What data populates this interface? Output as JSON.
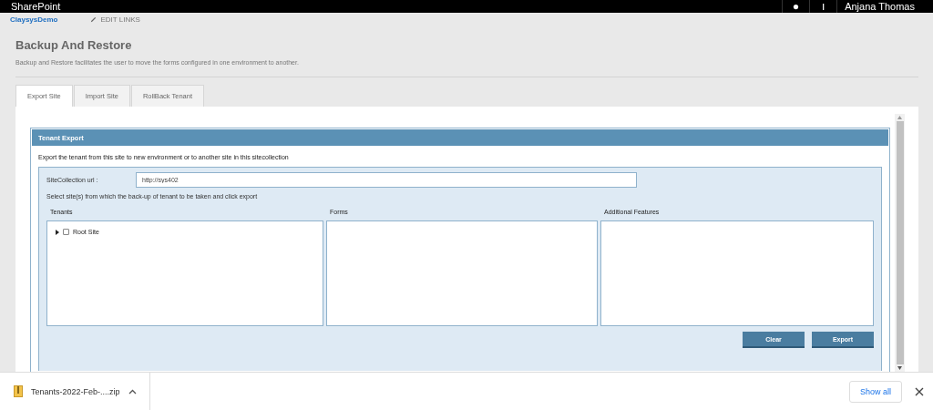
{
  "top_bar": {
    "brand": "SharePoint",
    "user": "Anjana Thomas"
  },
  "nav": {
    "site": "ClaysysDemo",
    "edit_links": "EDIT LINKS"
  },
  "page": {
    "title": "Backup And Restore",
    "description": "Backup and Restore facilitates the user to move the forms configured in one environment to another."
  },
  "tabs": [
    {
      "label": "Export Site",
      "selected": true
    },
    {
      "label": "Import Site",
      "selected": false
    },
    {
      "label": "RollBack Tenant",
      "selected": false
    }
  ],
  "panel": {
    "title": "Tenant Export",
    "intro": "Export the tenant from this site to new environment or to another site in this sitecollection",
    "url_label": "SiteCollection url :",
    "url_value": "http://sys402",
    "hint": "Select site(s) from which the back-up of tenant to be taken and click export",
    "columns": [
      {
        "heading": "Tenants",
        "items": [
          {
            "label": "Root Site",
            "checked": false,
            "expanded": false
          }
        ]
      },
      {
        "heading": "Forms"
      },
      {
        "heading": "Additional Features"
      }
    ],
    "buttons": [
      "Clear",
      "Export"
    ]
  },
  "download_bar": {
    "file": "Tenants-2022-Feb-....zip",
    "show_all": "Show all"
  }
}
